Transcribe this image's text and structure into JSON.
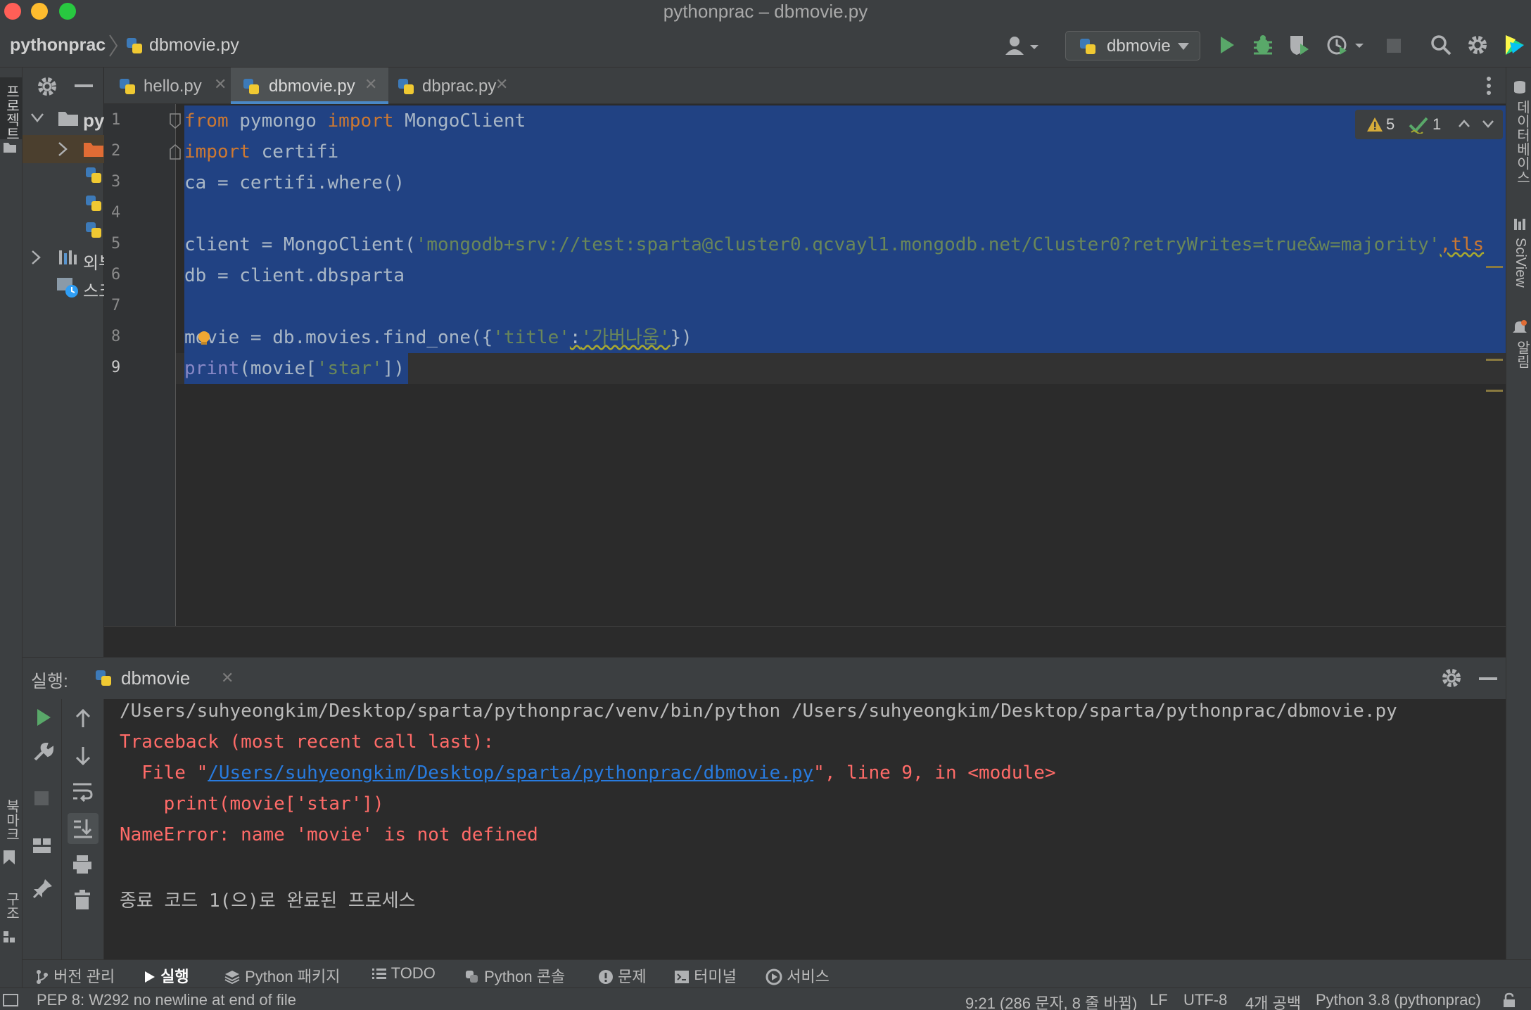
{
  "window": {
    "title": "pythonprac – dbmovie.py"
  },
  "navbar": {
    "project": "pythonprac",
    "file": "dbmovie.py",
    "run_config": "dbmovie"
  },
  "tabs": [
    {
      "label": "hello.py"
    },
    {
      "label": "dbmovie.py"
    },
    {
      "label": "dbprac.py"
    }
  ],
  "project_tree": {
    "root_label": "py",
    "external_label": "외부",
    "scratch_label": "스크"
  },
  "left_strip": {
    "project": "프로젝트",
    "bookmarks": "북마크",
    "structure": "구조"
  },
  "right_strip": {
    "database": "데이터베이스",
    "sciview": "SciView",
    "notifications": "알림"
  },
  "inspections": {
    "warnings": "5",
    "weak": "1"
  },
  "editor": {
    "line_numbers": [
      "1",
      "2",
      "3",
      "4",
      "5",
      "6",
      "7",
      "8",
      "9"
    ],
    "lines": {
      "l1": {
        "kw1": "from",
        "mod": " pymongo ",
        "kw2": "import",
        "name": " MongoClient"
      },
      "l2": {
        "kw": "import",
        "name": " certifi"
      },
      "l3": {
        "text": "ca = certifi.where()"
      },
      "l5": {
        "pre": "client = MongoClient(",
        "uri": "'mongodb+srv://test:sparta@cluster0.qcvayl1.mongodb.net/Cluster0?retryWrites=true&w=majority'",
        "post": ",tls"
      },
      "l6": {
        "text": "db = client.dbsparta"
      },
      "l8": {
        "pre": "movie = db.movies.find_one({",
        "key": "'title'",
        "colon": ":",
        "val": "'가버나움'",
        "post": "})"
      },
      "l9": {
        "fn": "print",
        "pre": "(movie[",
        "key": "'star'",
        "post": "])"
      }
    }
  },
  "run_panel": {
    "label": "실행:",
    "tab": "dbmovie",
    "output": {
      "cmd": "/Users/suhyeongkim/Desktop/sparta/pythonprac/venv/bin/python /Users/suhyeongkim/Desktop/sparta/pythonprac/dbmovie.py",
      "traceback": "Traceback (most recent call last):",
      "file_pre": "  File \"",
      "file_link": "/Users/suhyeongkim/Desktop/sparta/pythonprac/dbmovie.py",
      "file_post": "\", line 9, in <module>",
      "code": "    print(movie['star'])",
      "error": "NameError: name 'movie' is not defined",
      "exit": "종료 코드 1(으)로 완료된 프로세스"
    }
  },
  "bottom_tools": [
    {
      "label": "버전 관리",
      "icon": "branch-icon"
    },
    {
      "label": "실행",
      "icon": "run-icon"
    },
    {
      "label": "Python 패키지",
      "icon": "packages-icon"
    },
    {
      "label": "TODO",
      "icon": "list-icon"
    },
    {
      "label": "Python 콘솔",
      "icon": "python-icon"
    },
    {
      "label": "문제",
      "icon": "problems-icon"
    },
    {
      "label": "터미널",
      "icon": "terminal-icon"
    },
    {
      "label": "서비스",
      "icon": "services-icon"
    }
  ],
  "status": {
    "message": "PEP 8: W292 no newline at end of file",
    "position": "9:21 (286 문자, 8 줄 바뀜)",
    "line_sep": "LF",
    "encoding": "UTF-8",
    "indent": "4개 공백",
    "interpreter": "Python 3.8 (pythonprac)"
  },
  "colors": {
    "keyword": "#cc7832",
    "string": "#6a8759",
    "builtin": "#8888c6",
    "selection": "#214283",
    "error": "#ff6b68",
    "link": "#287bde",
    "run_green": "#59a869"
  }
}
